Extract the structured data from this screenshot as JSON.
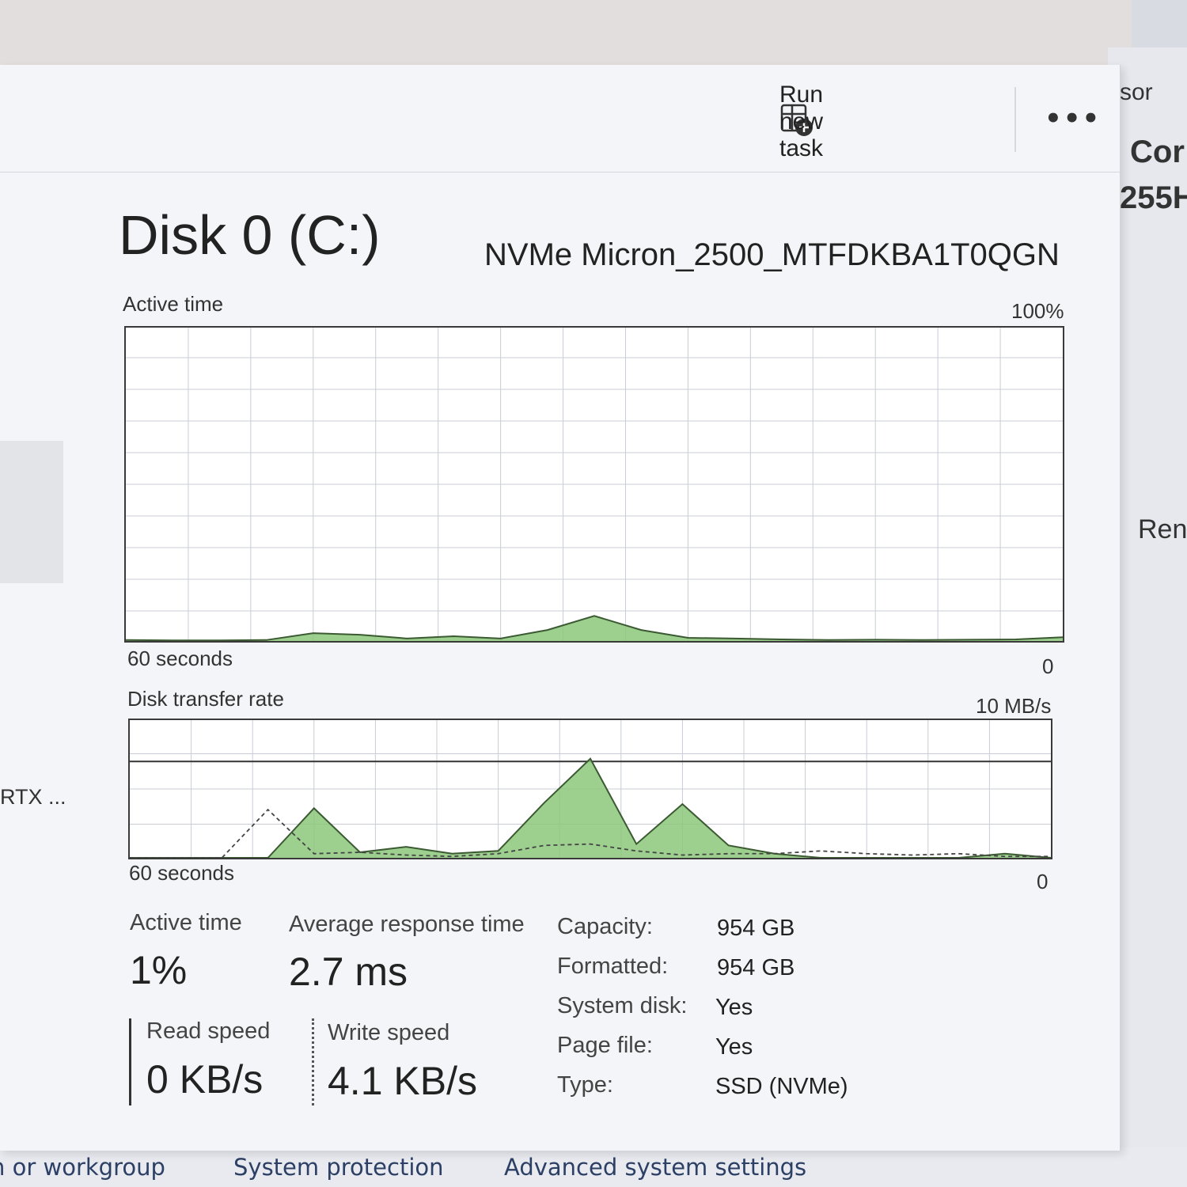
{
  "background": {
    "right_fragments": [
      "sor",
      "Cor",
      "255H",
      "Ren"
    ],
    "bottom_links": [
      "n or workgroup",
      "System protection",
      "Advanced system settings"
    ]
  },
  "toolbar": {
    "run_new_task_label": "Run new task",
    "more_label": "•••"
  },
  "sidebar": {
    "gpu_item_label": "RTX ..."
  },
  "disk": {
    "title": "Disk 0 (C:)",
    "model": "NVMe Micron_2500_MTFDKBA1T0QGN"
  },
  "active_time_chart": {
    "label": "Active time",
    "max_label": "100%",
    "time_label": "60 seconds",
    "min_label": "0"
  },
  "transfer_chart": {
    "label": "Disk transfer rate",
    "max_label": "10 MB/s",
    "line_label": "7 MB/s",
    "time_label": "60 seconds",
    "min_label": "0"
  },
  "chart_data": [
    {
      "type": "area",
      "title": "Active time",
      "ylim": [
        0,
        100
      ],
      "x": [
        0,
        3,
        6,
        9,
        12,
        15,
        18,
        21,
        24,
        27,
        30,
        33,
        36,
        39,
        42,
        45,
        48,
        51,
        54,
        57,
        60
      ],
      "series": [
        {
          "values": [
            0.3,
            0.2,
            0.2,
            0.3,
            2.5,
            2.0,
            0.8,
            1.5,
            0.8,
            3.5,
            8.0,
            3.5,
            1.0,
            0.8,
            0.5,
            0.3,
            0.4,
            0.3,
            0.4,
            0.5,
            1.2
          ]
        }
      ],
      "grid": true,
      "color": "#8cc77a"
    },
    {
      "type": "area",
      "title": "Disk transfer rate",
      "ylim": [
        0,
        10
      ],
      "reference_line": 7,
      "x": [
        0,
        3,
        6,
        9,
        12,
        15,
        18,
        21,
        24,
        27,
        30,
        33,
        36,
        39,
        42,
        45,
        48,
        51,
        54,
        57,
        60
      ],
      "series": [
        {
          "values": [
            0.0,
            0.0,
            0.0,
            0.0,
            3.6,
            0.4,
            0.8,
            0.3,
            0.5,
            4.0,
            7.2,
            1.0,
            3.9,
            0.9,
            0.3,
            0.0,
            0.0,
            0.0,
            0.0,
            0.3,
            0.0
          ]
        },
        {
          "values": [
            0.0,
            0.0,
            0.0,
            3.5,
            0.3,
            0.4,
            0.2,
            0.1,
            0.3,
            0.9,
            1.0,
            0.5,
            0.2,
            0.3,
            0.3,
            0.5,
            0.3,
            0.2,
            0.3,
            0.1,
            0.1
          ]
        }
      ],
      "grid": true,
      "color": "#8cc77a"
    }
  ],
  "stats": {
    "active_time_label": "Active time",
    "active_time_value": "1%",
    "avg_response_label": "Average response time",
    "avg_response_value": "2.7 ms",
    "read_speed_label": "Read speed",
    "read_speed_value": "0 KB/s",
    "write_speed_label": "Write speed",
    "write_speed_value": "4.1 KB/s"
  },
  "properties": [
    {
      "label": "Capacity:",
      "value": "954 GB"
    },
    {
      "label": "Formatted:",
      "value": "954 GB"
    },
    {
      "label": "System disk:",
      "value": "Yes"
    },
    {
      "label": "Page file:",
      "value": "Yes"
    },
    {
      "label": "Type:",
      "value": "SSD (NVMe)"
    }
  ]
}
